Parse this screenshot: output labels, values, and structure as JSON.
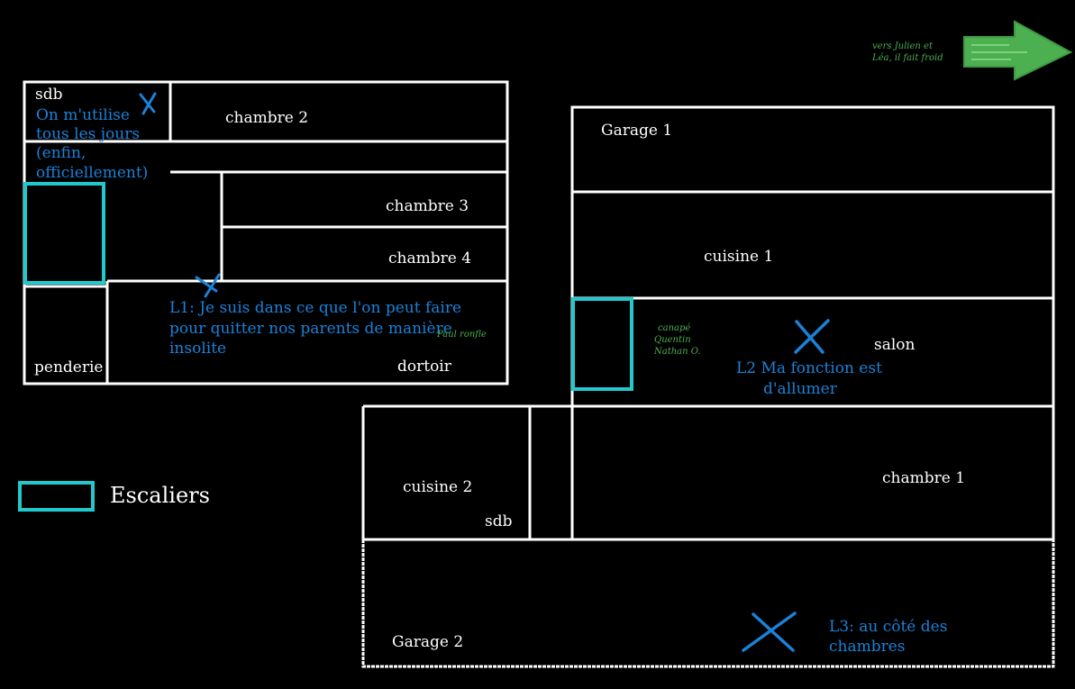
{
  "colors": {
    "background": "#000000",
    "walls": "#ffffff",
    "stairs": "#22c9cc",
    "notes": "#1a82d9",
    "green": "#4caf50"
  },
  "rooms": {
    "sdb_top": "sdb",
    "chambre2": "chambre 2",
    "chambre3": "chambre 3",
    "chambre4": "chambre 4",
    "penderie": "penderie",
    "dortoir": "dortoir",
    "garage1": "Garage 1",
    "cuisine1": "cuisine 1",
    "salon": "salon",
    "cuisine2": "cuisine 2",
    "sdb_bottom": "sdb",
    "chambre1": "chambre 1",
    "garage2": "Garage 2"
  },
  "notes": {
    "sdb_lines": [
      "On m'utilise",
      "tous les jours",
      "(enfin,",
      "officiellement)"
    ],
    "l1_lines": [
      "L1: Je suis dans ce que l'on peut faire",
      "pour quitter nos parents de manière",
      "insolite"
    ],
    "l2_line1": "L2  Ma fonction est",
    "l2_line2": "d'allumer",
    "l3_lines": [
      "L3: au côté des",
      "chambres"
    ],
    "paul": "Paul ronfle",
    "canape_lines": [
      "canapé",
      "Quentin",
      "Nathan O."
    ],
    "julien_lines": [
      "vers Julien et",
      "Léa, il fait froid"
    ]
  },
  "legend": {
    "label": "Escaliers"
  },
  "icons": {
    "cross": "x-mark-icon",
    "arrow": "arrow-right-icon"
  }
}
